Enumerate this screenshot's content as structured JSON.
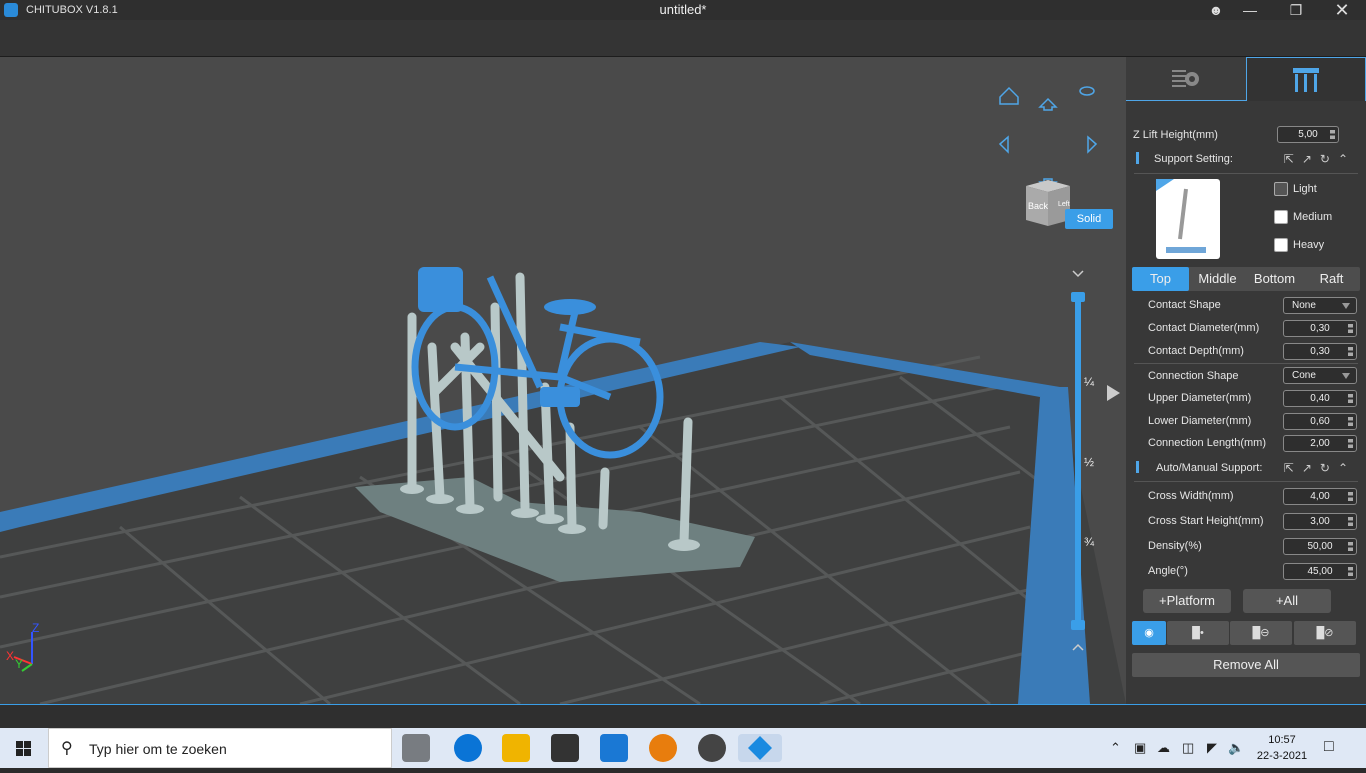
{
  "titlebar": {
    "app_name": "CHITUBOX V1.8.1",
    "doc_title": "untitled*"
  },
  "viewport": {
    "render_mode_button": "Solid",
    "view_cube": {
      "front_face": "Back",
      "side_face": "Left"
    },
    "slider_labels": [
      "¼",
      "½",
      "¾"
    ],
    "axis_labels": {
      "x": "X",
      "y": "Y",
      "z": "Z"
    }
  },
  "panel": {
    "z_lift": {
      "label": "Z Lift Height(mm)",
      "value": "5,00"
    },
    "support_setting": {
      "title": "Support Setting:",
      "presets": [
        "Light",
        "Medium",
        "Heavy"
      ]
    },
    "tabs": [
      "Top",
      "Middle",
      "Bottom",
      "Raft"
    ],
    "active_tab": "Top",
    "top_fields": [
      {
        "label": "Contact Shape",
        "value": "None",
        "type": "select"
      },
      {
        "label": "Contact Diameter(mm)",
        "value": "0,30",
        "type": "number"
      },
      {
        "label": "Contact Depth(mm)",
        "value": "0,30",
        "type": "number"
      },
      {
        "label": "Connection Shape",
        "value": "Cone",
        "type": "select"
      },
      {
        "label": "Upper Diameter(mm)",
        "value": "0,40",
        "type": "number"
      },
      {
        "label": "Lower Diameter(mm)",
        "value": "0,60",
        "type": "number"
      },
      {
        "label": "Connection Length(mm)",
        "value": "2,00",
        "type": "number"
      }
    ],
    "auto_manual": {
      "title": "Auto/Manual Support:",
      "fields": [
        {
          "label": "Cross Width(mm)",
          "value": "4,00"
        },
        {
          "label": "Cross Start Height(mm)",
          "value": "3,00"
        },
        {
          "label": "Density(%)",
          "value": "50,00"
        },
        {
          "label": "Angle(°)",
          "value": "45,00"
        }
      ]
    },
    "buttons": {
      "platform": "+Platform",
      "all": "+All",
      "remove_all": "Remove All"
    }
  },
  "taskbar": {
    "search_placeholder": "Typ hier om te zoeken",
    "time": "10:57",
    "date": "22-3-2021"
  },
  "colors": {
    "accent": "#3a9ee8",
    "model": "#3a8fdc",
    "support": "#b8c8c8"
  }
}
